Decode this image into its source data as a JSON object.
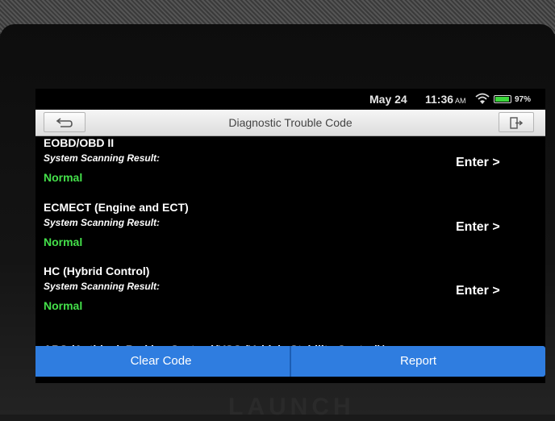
{
  "status_bar": {
    "date": "May 24",
    "time": "11:36",
    "ampm": "AM",
    "battery_percent": "97%",
    "battery_level": 0.97,
    "battery_color": "#3cd63c"
  },
  "title_bar": {
    "title": "Diagnostic Trouble Code",
    "back_icon": "back-arrow-icon",
    "exit_icon": "exit-icon"
  },
  "systems": [
    {
      "name": "EOBD/OBD II",
      "scan_label": "System Scanning Result:",
      "status": "Normal",
      "action": "Enter >"
    },
    {
      "name": "ECMECT (Engine and ECT)",
      "scan_label": "System Scanning Result:",
      "status": "Normal",
      "action": "Enter >"
    },
    {
      "name": "HC (Hybrid Control)",
      "scan_label": "System Scanning Result:",
      "status": "Normal",
      "action": "Enter >"
    },
    {
      "name": "ABS (Anti-lock Braking System)/VSC (Vehicle Stability Control)/"
    }
  ],
  "colors": {
    "status_normal": "#44e04a",
    "action_bar": "#2f7de0"
  },
  "actions": {
    "clear_code": "Clear Code",
    "report": "Report"
  },
  "brand": "LAUNCH"
}
